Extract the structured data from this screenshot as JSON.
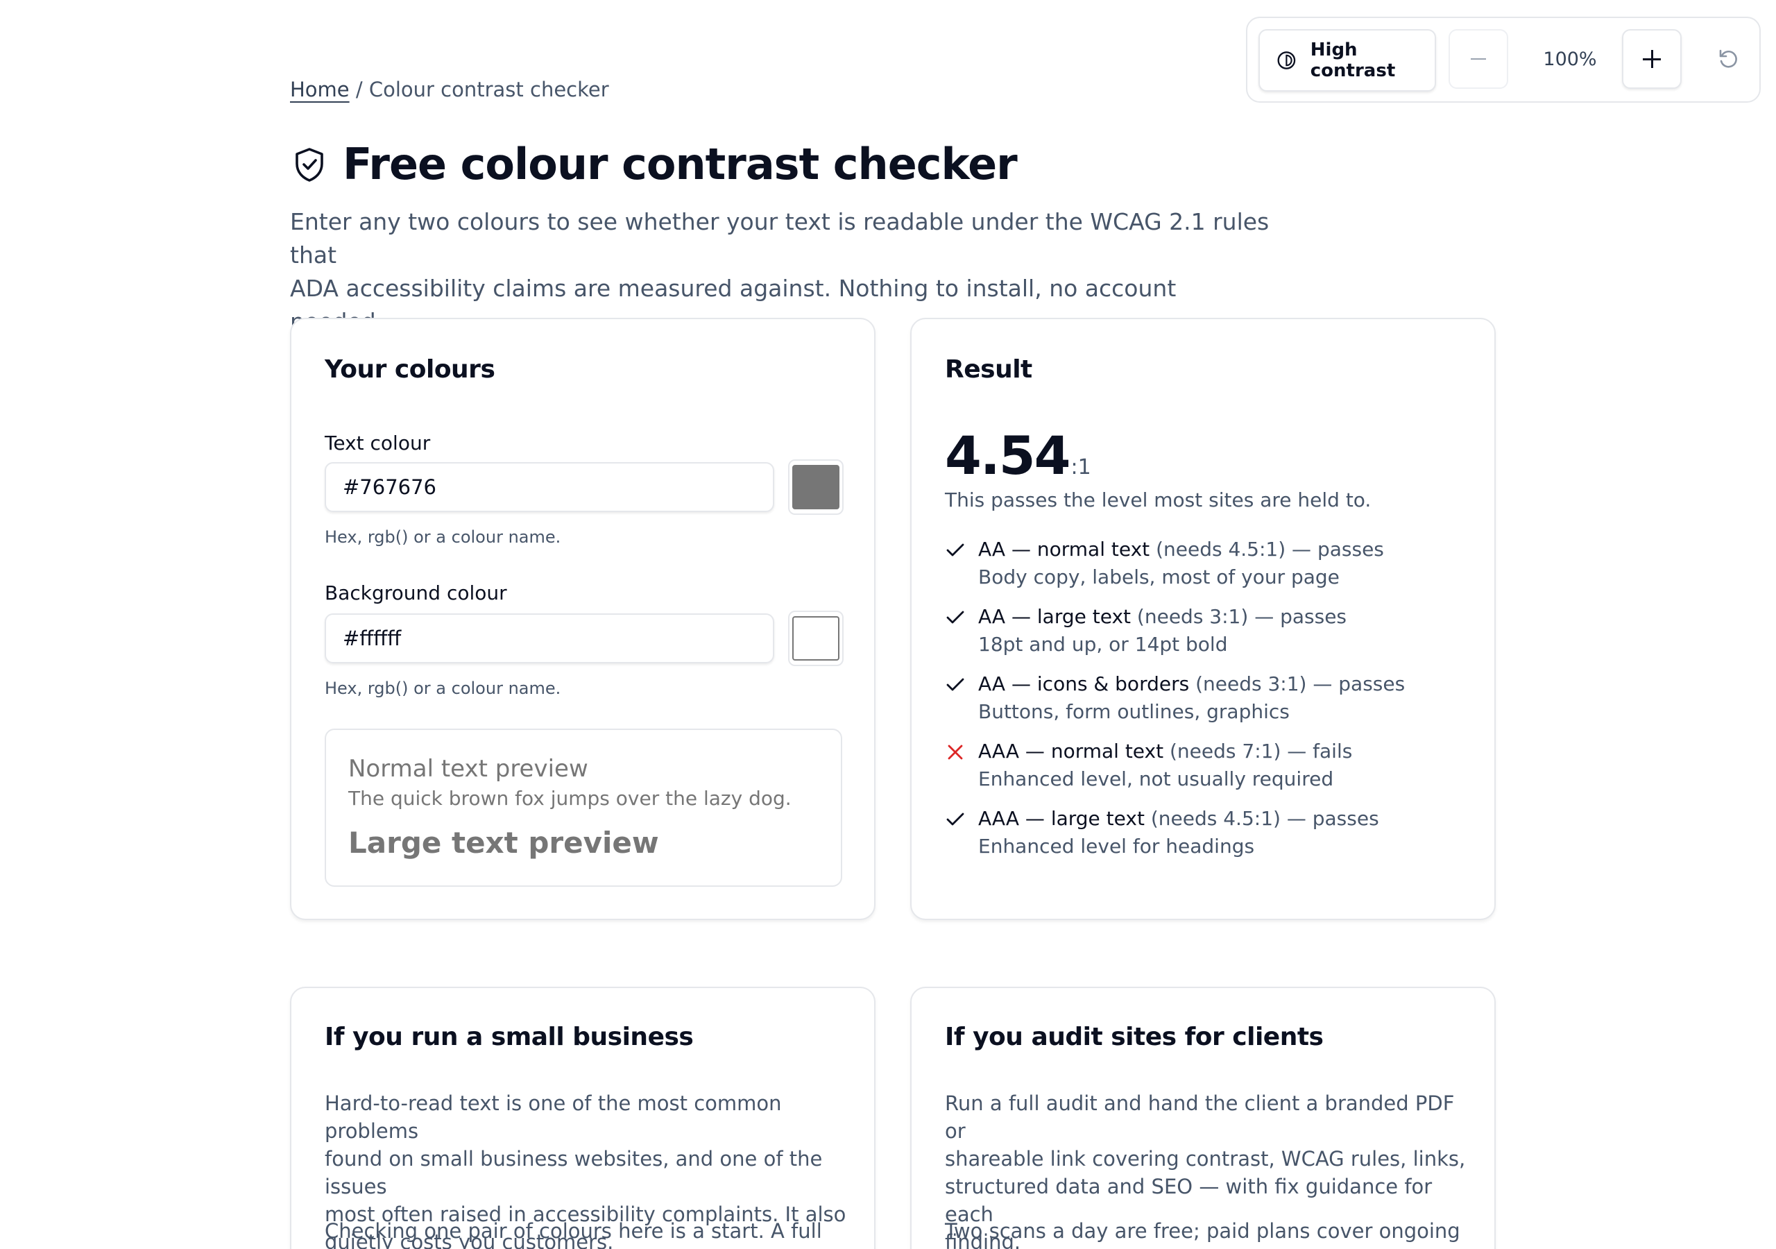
{
  "toolbar": {
    "high_contrast_label": "High contrast",
    "zoom_level": "100%",
    "icons": {
      "contrast": "contrast-half-circle-icon",
      "zoom_out": "minus-icon",
      "zoom_in": "plus-icon",
      "reset": "reset-rotate-icon"
    }
  },
  "breadcrumb": {
    "home": "Home",
    "separator": "/",
    "current": "Colour contrast checker"
  },
  "header": {
    "title": "Free colour contrast checker",
    "title_icon": "shield-check-icon",
    "intro_line1": "Enter any two colours to see whether your text is readable under the WCAG 2.1 rules that",
    "intro_line2": "ADA accessibility claims are measured against. Nothing to install, no account needed."
  },
  "colours_card": {
    "title": "Your colours",
    "text_colour": {
      "label": "Text colour",
      "value": "#767676",
      "hint": "Hex, rgb() or a colour name.",
      "swatch": "#767676"
    },
    "background_colour": {
      "label": "Background colour",
      "value": "#ffffff",
      "hint": "Hex, rgb() or a colour name.",
      "swatch": "#ffffff"
    },
    "preview": {
      "normal_heading": "Normal text preview",
      "normal_body": "The quick brown fox jumps over the lazy dog.",
      "large": "Large text preview"
    }
  },
  "result_card": {
    "title": "Result",
    "ratio": "4.54",
    "ratio_suffix": ":1",
    "verdict": "This passes the level most sites are held to.",
    "checks": [
      {
        "status": "pass",
        "name": "AA — normal text",
        "detail": " (needs 4.5:1) — passes",
        "desc": "Body copy, labels, most of your page"
      },
      {
        "status": "pass",
        "name": "AA — large text",
        "detail": " (needs 3:1) — passes",
        "desc": "18pt and up, or 14pt bold"
      },
      {
        "status": "pass",
        "name": "AA — icons & borders",
        "detail": " (needs 3:1) — passes",
        "desc": "Buttons, form outlines, graphics"
      },
      {
        "status": "fail",
        "name": "AAA — normal text",
        "detail": " (needs 7:1) — fails",
        "desc": "Enhanced level, not usually required"
      },
      {
        "status": "pass",
        "name": "AAA — large text",
        "detail": " (needs 4.5:1) — passes",
        "desc": "Enhanced level for headings"
      }
    ]
  },
  "business_card": {
    "title": "If you run a small business",
    "para1_lines": [
      "Hard-to-read text is one of the most common problems",
      "found on small business websites, and one of the issues",
      "most often raised in accessibility complaints. It also",
      "quietly costs you customers."
    ],
    "para2_line1": "Checking one pair of colours here is a start. A full scan"
  },
  "audit_card": {
    "title": "If you audit sites for clients",
    "para1_lines": [
      "Run a full audit and hand the client a branded PDF or",
      "shareable link covering contrast, WCAG rules, links,",
      "structured data and SEO — with fix guidance for each",
      "finding."
    ],
    "para2_line1": "Two scans a day are free; paid plans cover ongoing"
  },
  "colors": {
    "pass": "#0b1020",
    "fail": "#dc2626",
    "text": "#0b1020",
    "muted": "#475569",
    "border": "#e5e7eb"
  }
}
